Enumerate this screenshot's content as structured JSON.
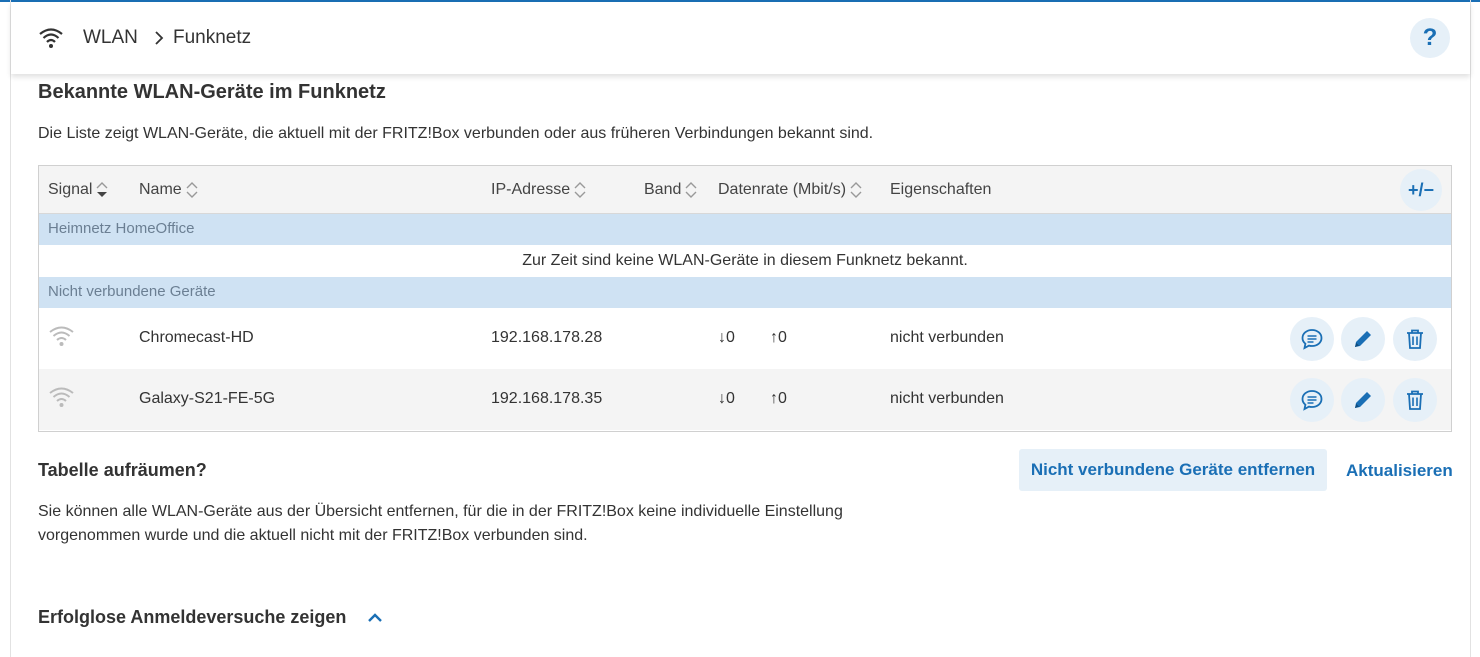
{
  "breadcrumb": {
    "root": "WLAN",
    "current": "Funknetz"
  },
  "help": {
    "label": "?"
  },
  "page": {
    "title": "Bekannte WLAN-Geräte im Funknetz",
    "description": "Die Liste zeigt WLAN-Geräte, die aktuell mit der FRITZ!Box verbunden oder aus früheren Verbindungen bekannt sind."
  },
  "table": {
    "columns": {
      "signal": "Signal",
      "name": "Name",
      "ip": "IP-Adresse",
      "band": "Band",
      "rate": "Datenrate (Mbit/s)",
      "props": "Eigenschaften"
    },
    "toggle_columns_label": "+/−",
    "groups": [
      {
        "label": "Heimnetz HomeOffice",
        "empty_text": "Zur Zeit sind keine WLAN-Geräte in diesem Funknetz bekannt."
      },
      {
        "label": "Nicht verbundene Geräte"
      }
    ],
    "rows": [
      {
        "name": "Chromecast-HD",
        "ip": "192.168.178.28",
        "down": "↓0",
        "up": "↑0",
        "status": "nicht verbunden"
      },
      {
        "name": "Galaxy-S21-FE-5G",
        "ip": "192.168.178.35",
        "down": "↓0",
        "up": "↑0",
        "status": "nicht verbunden"
      }
    ]
  },
  "cleanup": {
    "title": "Tabelle aufräumen?",
    "remove_button": "Nicht verbundene Geräte entfernen",
    "refresh_button": "Aktualisieren",
    "text": "Sie können alle WLAN-Geräte aus der Übersicht entfernen, für die in der FRITZ!Box keine individuelle Einstellung vorgenommen wurde und die aktuell nicht mit der FRITZ!Box verbunden sind."
  },
  "failed_logins": {
    "label": "Erfolglose Anmeldeversuche zeigen"
  },
  "colors": {
    "accent": "#1a6fb5",
    "group_bg": "#cfe2f3",
    "button_bg": "#e6f0f8"
  },
  "icons": [
    "wifi-icon",
    "chevron-right-icon",
    "help-icon",
    "sort-icon",
    "wifi-signal-icon",
    "chat-icon",
    "pencil-icon",
    "trash-icon",
    "chevron-up-icon"
  ]
}
